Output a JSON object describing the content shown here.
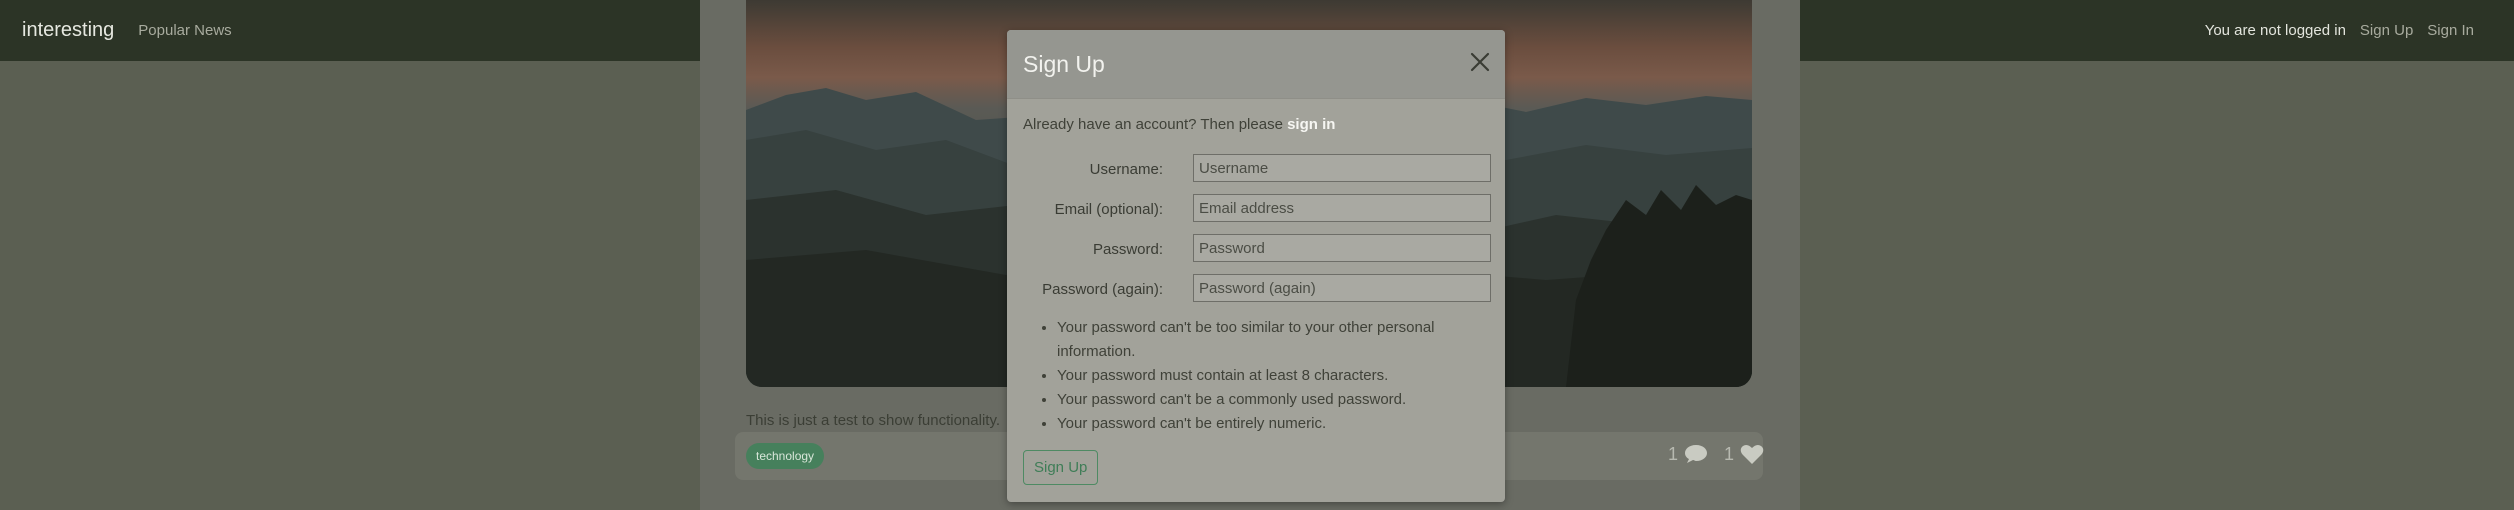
{
  "navbar": {
    "brand": "interesting",
    "popular_link": "Popular News",
    "status": "You are not logged in",
    "signup_link": "Sign Up",
    "signin_link": "Sign In"
  },
  "post": {
    "text": "This is just a test to show functionality.",
    "tag": "technology",
    "comment_count": "1",
    "like_count": "1"
  },
  "modal": {
    "title": "Sign Up",
    "intro": "Already have an account? Then please ",
    "signin_link": "sign in",
    "fields": [
      {
        "label": "Username:",
        "placeholder": "Username"
      },
      {
        "label": "Email (optional):",
        "placeholder": "Email address"
      },
      {
        "label": "Password:",
        "placeholder": "Password"
      },
      {
        "label": "Password (again):",
        "placeholder": "Password (again)"
      }
    ],
    "rules": [
      "Your password can't be too similar to your other personal information.",
      "Your password must contain at least 8 characters.",
      "Your password can't be a commonly used password.",
      "Your password can't be entirely numeric."
    ],
    "submit_label": "Sign Up"
  },
  "colors": {
    "accent_green": "#3f7d57",
    "navbar": "#2c3426",
    "modal_bg": "#a2a29a"
  },
  "icons": [
    "close-icon",
    "comment-icon",
    "heart-icon"
  ]
}
